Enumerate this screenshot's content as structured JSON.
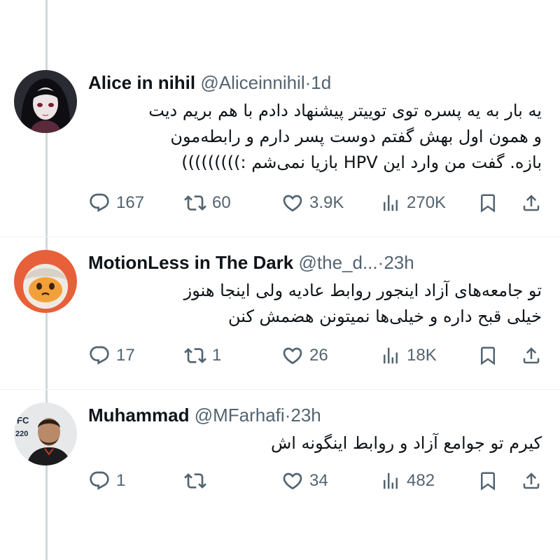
{
  "colors": {
    "text": "#0f1419",
    "secondary": "#536471",
    "thread_line": "#cfd9de",
    "background": "#ffffff"
  },
  "tweets": [
    {
      "display_name": "Alice in nihil",
      "handle": "@Aliceinnihil",
      "dot": "·",
      "time": "1d",
      "avatar_icon": "anime-girl-avatar",
      "lines": [
        "یه بار به یه پسره توی توییتر پیشنهاد دادم با هم بریم دیت",
        "و همون اول بهش گفتم دوست پسر دارم و رابطه‌مون",
        "بازه. گفت من وارد این HPV بازیا نمی‌شم :)))))))))"
      ],
      "replies": "167",
      "retweets": "60",
      "likes": "3.9K",
      "views": "270K"
    },
    {
      "display_name": "MotionLess in The Dark",
      "handle": "@the_d...",
      "dot": "·",
      "time": "23h",
      "avatar_icon": "plush-toy-avatar",
      "lines": [
        "تو جامعه‌های آزاد اینجور روابط  عادیه ولی اینجا هنوز",
        "خیلی قبح داره و خیلی‌ها نمیتونن هضمش کنن"
      ],
      "replies": "17",
      "retweets": "1",
      "likes": "26",
      "views": "18K"
    },
    {
      "display_name": "Muhammad",
      "handle": "@MFarhafi",
      "dot": "·",
      "time": "23h",
      "avatar_icon": "fighter-photo-avatar",
      "lines": [
        "کیرم تو جوامع آزاد و روابط اینگونه اش"
      ],
      "replies": "1",
      "retweets": "",
      "likes": "34",
      "views": "482"
    }
  ]
}
